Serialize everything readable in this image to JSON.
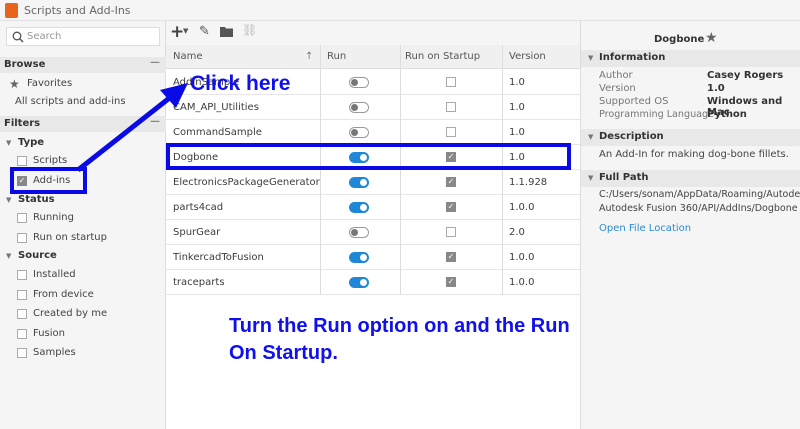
{
  "window": {
    "title": "Scripts and Add-Ins"
  },
  "search": {
    "placeholder": "Search"
  },
  "browse": {
    "header": "Browse",
    "favorites": "Favorites",
    "all": "All scripts and add-ins"
  },
  "filters": {
    "header": "Filters",
    "type": {
      "label": "Type",
      "items": [
        {
          "label": "Scripts",
          "checked": false
        },
        {
          "label": "Add-ins",
          "checked": true
        }
      ]
    },
    "status": {
      "label": "Status",
      "items": [
        {
          "label": "Running"
        },
        {
          "label": "Run on startup"
        }
      ]
    },
    "source": {
      "label": "Source",
      "items": [
        {
          "label": "Installed"
        },
        {
          "label": "From device"
        },
        {
          "label": "Created by me"
        },
        {
          "label": "Fusion"
        },
        {
          "label": "Samples"
        }
      ]
    }
  },
  "table": {
    "columns": [
      "Name",
      "Run",
      "Run on Startup",
      "Version"
    ],
    "rows": [
      {
        "name": "AddInSample",
        "run": false,
        "startup": false,
        "version": "1.0"
      },
      {
        "name": "CAM_API_Utilities",
        "run": false,
        "startup": false,
        "version": "1.0"
      },
      {
        "name": "CommandSample",
        "run": false,
        "startup": false,
        "version": "1.0"
      },
      {
        "name": "Dogbone",
        "run": true,
        "startup": true,
        "version": "1.0"
      },
      {
        "name": "ElectronicsPackageGenerator",
        "run": true,
        "startup": true,
        "version": "1.1.928"
      },
      {
        "name": "parts4cad",
        "run": true,
        "startup": true,
        "version": "1.0.0"
      },
      {
        "name": "SpurGear",
        "run": false,
        "startup": false,
        "version": "2.0"
      },
      {
        "name": "TinkercadToFusion",
        "run": true,
        "startup": true,
        "version": "1.0.0"
      },
      {
        "name": "traceparts",
        "run": true,
        "startup": true,
        "version": "1.0.0"
      }
    ]
  },
  "details": {
    "name": "Dogbone",
    "info_header": "Information",
    "info": [
      {
        "label": "Author",
        "value": "Casey Rogers"
      },
      {
        "label": "Version",
        "value": "1.0"
      },
      {
        "label": "Supported OS",
        "value": "Windows and Mac"
      },
      {
        "label": "Programming Language",
        "value": "Python"
      }
    ],
    "desc_header": "Description",
    "description": "An Add-In for making dog-bone fillets.",
    "path_header": "Full Path",
    "path1": "C:/Users/sonam/AppData/Roaming/Autodesk/",
    "path2": "Autodesk Fusion 360/API/AddIns/Dogbone",
    "open_link": "Open File Location"
  },
  "annotations": {
    "click": "Click here",
    "instruction1": "Turn the Run option on and the Run",
    "instruction2": "On Startup."
  },
  "colors": {
    "accent": "#1e88d6",
    "annotation": "#0a0ae6"
  }
}
